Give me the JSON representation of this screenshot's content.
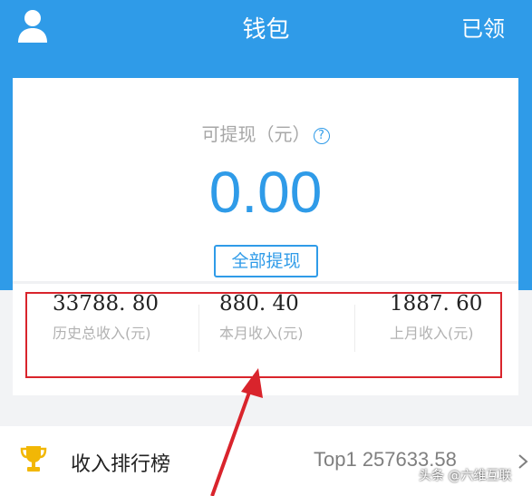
{
  "header": {
    "title": "钱包",
    "right_action": "已领",
    "user_icon": "user-icon"
  },
  "balance": {
    "label": "可提现（元）",
    "help_icon": "question-mark-icon",
    "help_glyph": "?",
    "amount": "0.00",
    "withdraw_all_label": "全部提现"
  },
  "stats": [
    {
      "value": "33788. 80",
      "label": "历史总收入(元)"
    },
    {
      "value": "880. 40",
      "label": "本月收入(元)"
    },
    {
      "value": "1887. 60",
      "label": "上月收入(元)"
    }
  ],
  "ranking": {
    "icon": "trophy-icon",
    "label": "收入排行榜",
    "value": "Top1 257633.58",
    "chevron": "chevron-right-icon"
  },
  "watermark": "头条 @六维互联",
  "colors": {
    "accent": "#2f9be8",
    "highlight": "#d9242c",
    "trophy": "#f2b705"
  }
}
